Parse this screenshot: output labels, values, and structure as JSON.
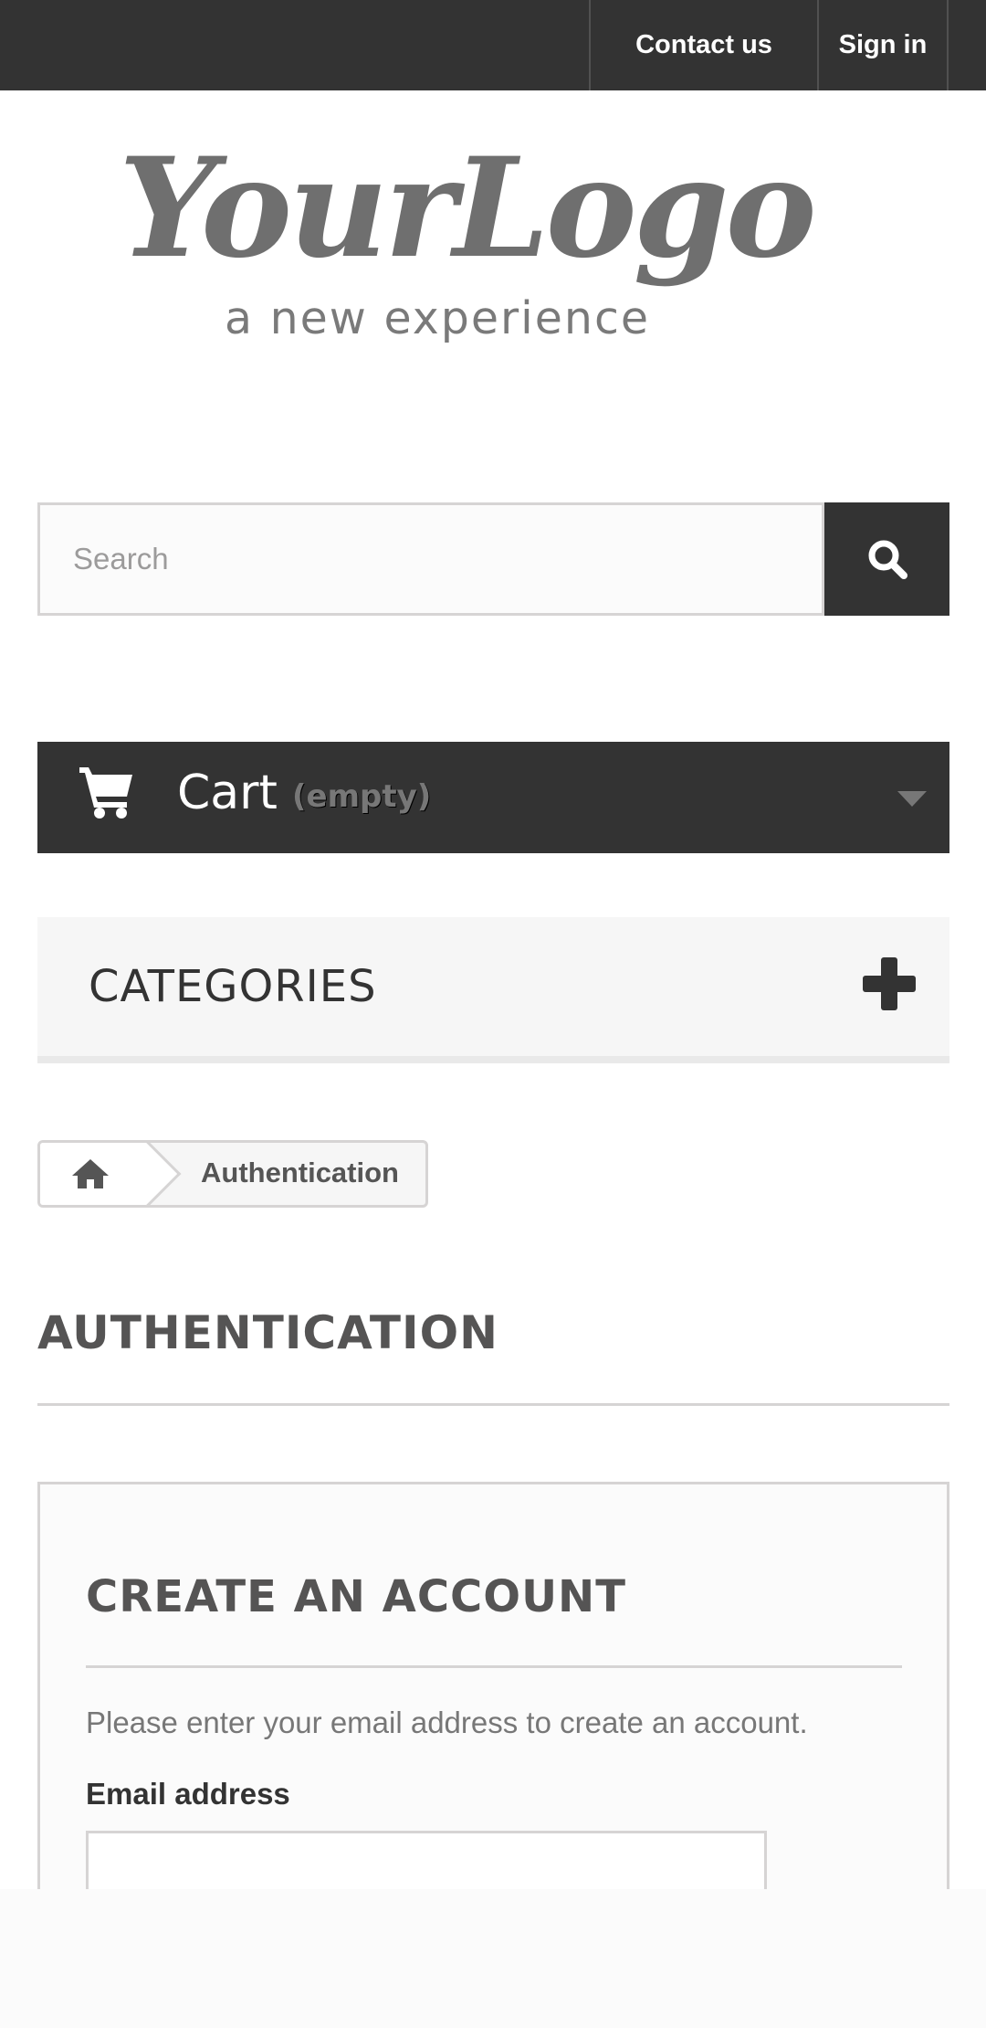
{
  "header": {
    "nav": {
      "contact_label": "Contact us",
      "signin_label": "Sign in"
    }
  },
  "logo": {
    "wordmark": "YourLogo",
    "tagline": "a new experience"
  },
  "search": {
    "placeholder": "Search",
    "button_icon": "search-icon"
  },
  "cart": {
    "icon": "cart-icon",
    "label": "Cart",
    "status": "(empty)",
    "toggle_icon": "caret-down-icon"
  },
  "categories": {
    "label": "CATEGORIES",
    "toggle_icon": "plus-icon"
  },
  "breadcrumb": {
    "home_icon": "home-icon",
    "current": "Authentication"
  },
  "page": {
    "heading": "AUTHENTICATION"
  },
  "create_account": {
    "title": "CREATE AN ACCOUNT",
    "description": "Please enter your email address to create an account.",
    "email_label": "Email address",
    "email_value": ""
  },
  "colors": {
    "dark": "#333333",
    "border": "#d6d4d4",
    "panel": "#f6f6f6",
    "muted_text": "#777777"
  }
}
